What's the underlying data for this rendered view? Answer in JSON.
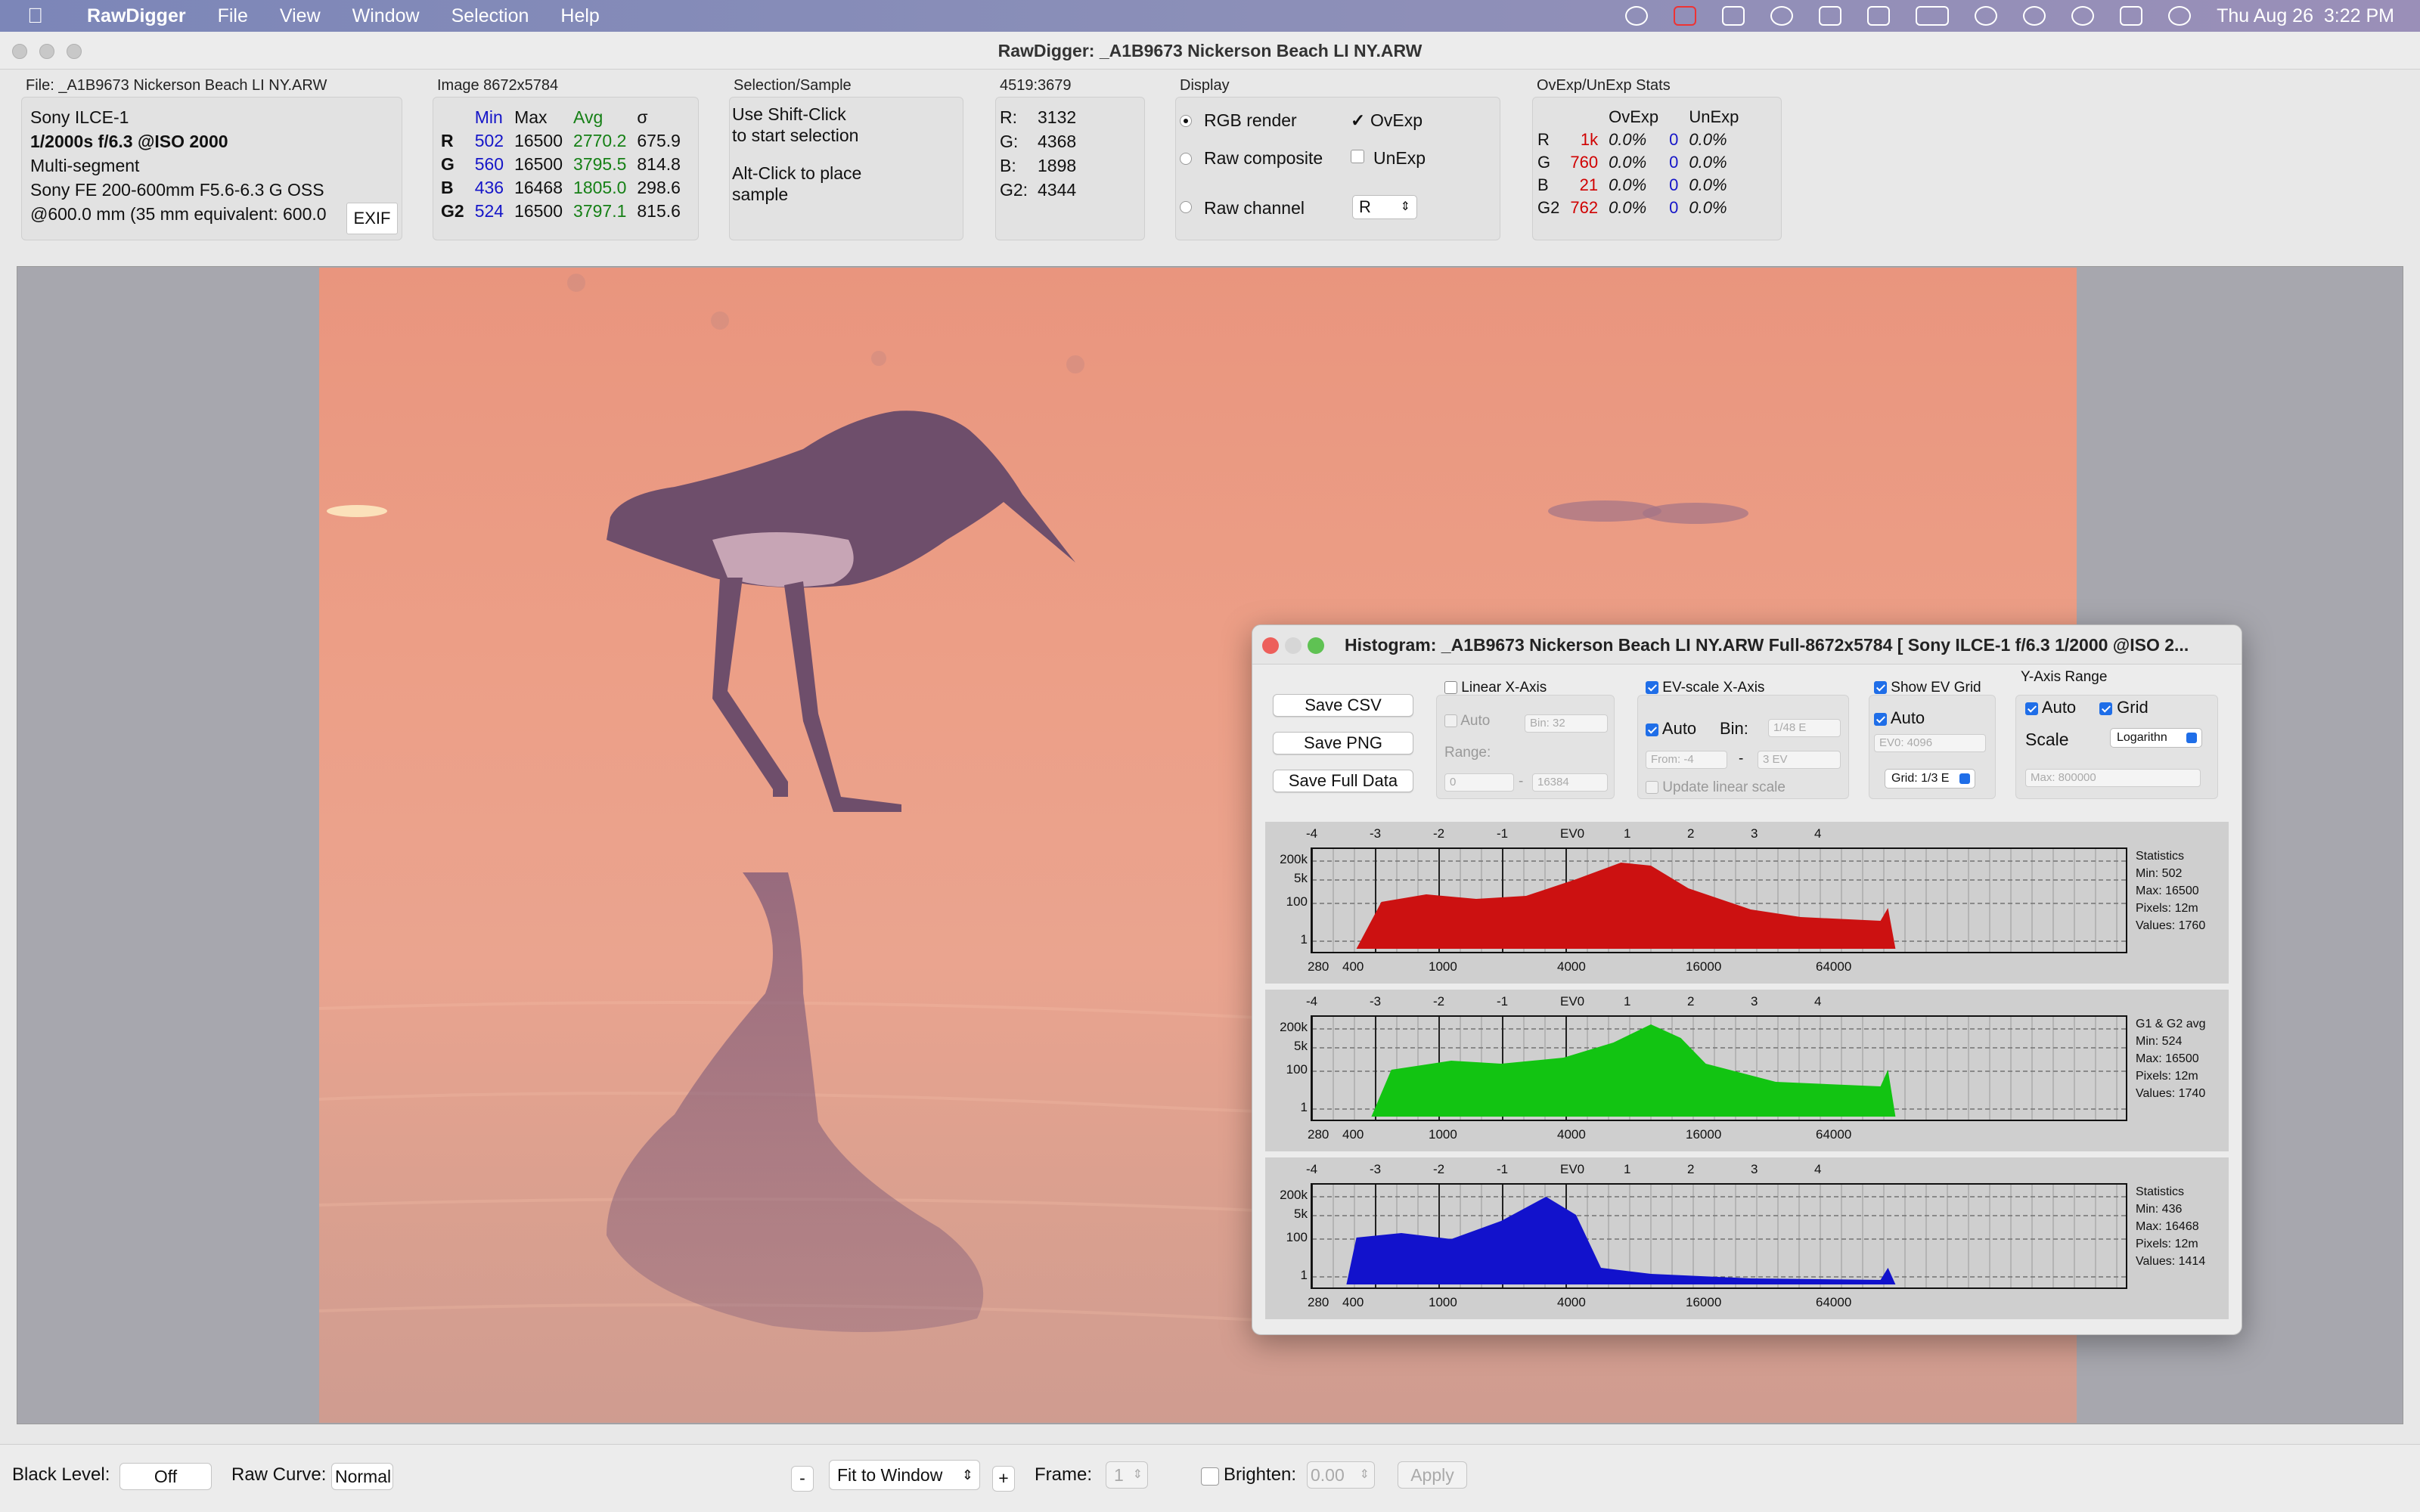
{
  "menubar": {
    "app": "RawDigger",
    "items": [
      "File",
      "View",
      "Window",
      "Selection",
      "Help"
    ],
    "clock": "Thu Aug 26  3:22 PM"
  },
  "window": {
    "title": "RawDigger: _A1B9673 Nickerson Beach LI NY.ARW"
  },
  "file_panel": {
    "label": "File: _A1B9673 Nickerson Beach LI NY.ARW",
    "camera": "Sony ILCE-1",
    "exposure": "1/2000s f/6.3 @ISO 2000",
    "metering": "Multi-segment",
    "lens": "Sony FE 200-600mm F5.6-6.3 G OSS",
    "focal": "@600.0 mm (35 mm equivalent: 600.0",
    "exif_button": "EXIF"
  },
  "image_panel": {
    "label": "Image 8672x5784",
    "headers": [
      "Min",
      "Max",
      "Avg",
      "σ"
    ],
    "rows": [
      {
        "ch": "R",
        "min": "502",
        "max": "16500",
        "avg": "2770.2",
        "sd": "675.9"
      },
      {
        "ch": "G",
        "min": "560",
        "max": "16500",
        "avg": "3795.5",
        "sd": "814.8"
      },
      {
        "ch": "B",
        "min": "436",
        "max": "16468",
        "avg": "1805.0",
        "sd": "298.6"
      },
      {
        "ch": "G2",
        "min": "524",
        "max": "16500",
        "avg": "3797.1",
        "sd": "815.6"
      }
    ]
  },
  "selection_panel": {
    "label": "Selection/Sample",
    "line1": "Use Shift-Click",
    "line2": "to start selection",
    "line3": "Alt-Click to place",
    "line4": "sample"
  },
  "coords_panel": {
    "label": "4519:3679",
    "rows": [
      {
        "k": "R:",
        "v": "3132"
      },
      {
        "k": "G:",
        "v": "4368"
      },
      {
        "k": "B:",
        "v": "1898"
      },
      {
        "k": "G2:",
        "v": "4344"
      }
    ]
  },
  "display_panel": {
    "label": "Display",
    "rgb_render": "RGB render",
    "raw_composite": "Raw composite",
    "raw_channel": "Raw channel",
    "ovexp": "OvExp",
    "unexp": "UnExp",
    "channel_value": "R",
    "selected_mode": "RGB render"
  },
  "ovexp_panel": {
    "label": "OvExp/UnExp Stats",
    "headers": [
      "OvExp",
      "UnExp"
    ],
    "rows": [
      {
        "ch": "R",
        "ov": "1k",
        "ovp": "0.0%",
        "un": "0",
        "unp": "0.0%"
      },
      {
        "ch": "G",
        "ov": "760",
        "ovp": "0.0%",
        "un": "0",
        "unp": "0.0%"
      },
      {
        "ch": "B",
        "ov": "21",
        "ovp": "0.0%",
        "un": "0",
        "unp": "0.0%"
      },
      {
        "ch": "G2",
        "ov": "762",
        "ovp": "0.0%",
        "un": "0",
        "unp": "0.0%"
      }
    ]
  },
  "histogram": {
    "title": "Histogram: _A1B9673 Nickerson Beach LI NY.ARW Full-8672x5784 [ Sony ILCE-1 f/6.3 1/2000 @ISO 2...",
    "buttons": [
      "Save CSV",
      "Save PNG",
      "Save Full Data"
    ],
    "linear": {
      "title": "Linear X-Axis",
      "auto": "Auto",
      "bin": "Bin: 32",
      "range_label": "Range:",
      "from": "0",
      "to": "16384"
    },
    "ev": {
      "title": "EV-scale X-Axis",
      "auto": "Auto",
      "bin_label": "Bin:",
      "bin": "1/48 E",
      "from": "From: -4",
      "dash": "-",
      "to": "3 EV",
      "update": "Update linear scale"
    },
    "evgrid": {
      "title": "Show EV Grid",
      "auto": "Auto",
      "ev0": "EV0: 4096",
      "grid": "Grid: 1/3 E"
    },
    "yaxis": {
      "title": "Y-Axis Range",
      "auto": "Auto",
      "grid": "Grid",
      "scale_label": "Scale",
      "scale": "Logarithn",
      "max": "Max: 800000"
    },
    "axes": {
      "ev_ticks": [
        "-4",
        "-3",
        "-2",
        "-1",
        "EV0",
        "1",
        "2",
        "3",
        "4"
      ],
      "y_ticks": [
        "200k",
        "5k",
        "100",
        "1"
      ],
      "x_ticks": [
        "280",
        "400",
        "1000",
        "4000",
        "16000",
        "64000"
      ]
    },
    "panels": [
      {
        "color": "#cc1111",
        "stats": [
          "Statistics",
          "Min: 502",
          "Max: 16500",
          "Pixels: 12m",
          "Values: 1760"
        ]
      },
      {
        "color": "#12c412",
        "stats": [
          "G1 & G2 avg",
          "Min: 524",
          "Max: 16500",
          "Pixels: 12m",
          "Values: 1740"
        ]
      },
      {
        "color": "#1212cc",
        "stats": [
          "Statistics",
          "Min: 436",
          "Max: 16468",
          "Pixels: 12m",
          "Values: 1414"
        ]
      }
    ]
  },
  "bottombar": {
    "black_level_label": "Black Level:",
    "black_level": "Off",
    "raw_curve_label": "Raw Curve:",
    "raw_curve": "Normal",
    "minus": "-",
    "fit": "Fit to Window",
    "plus": "+",
    "frame_label": "Frame:",
    "frame": "1",
    "brighten_label": "Brighten:",
    "brighten": "0.00",
    "apply": "Apply"
  }
}
